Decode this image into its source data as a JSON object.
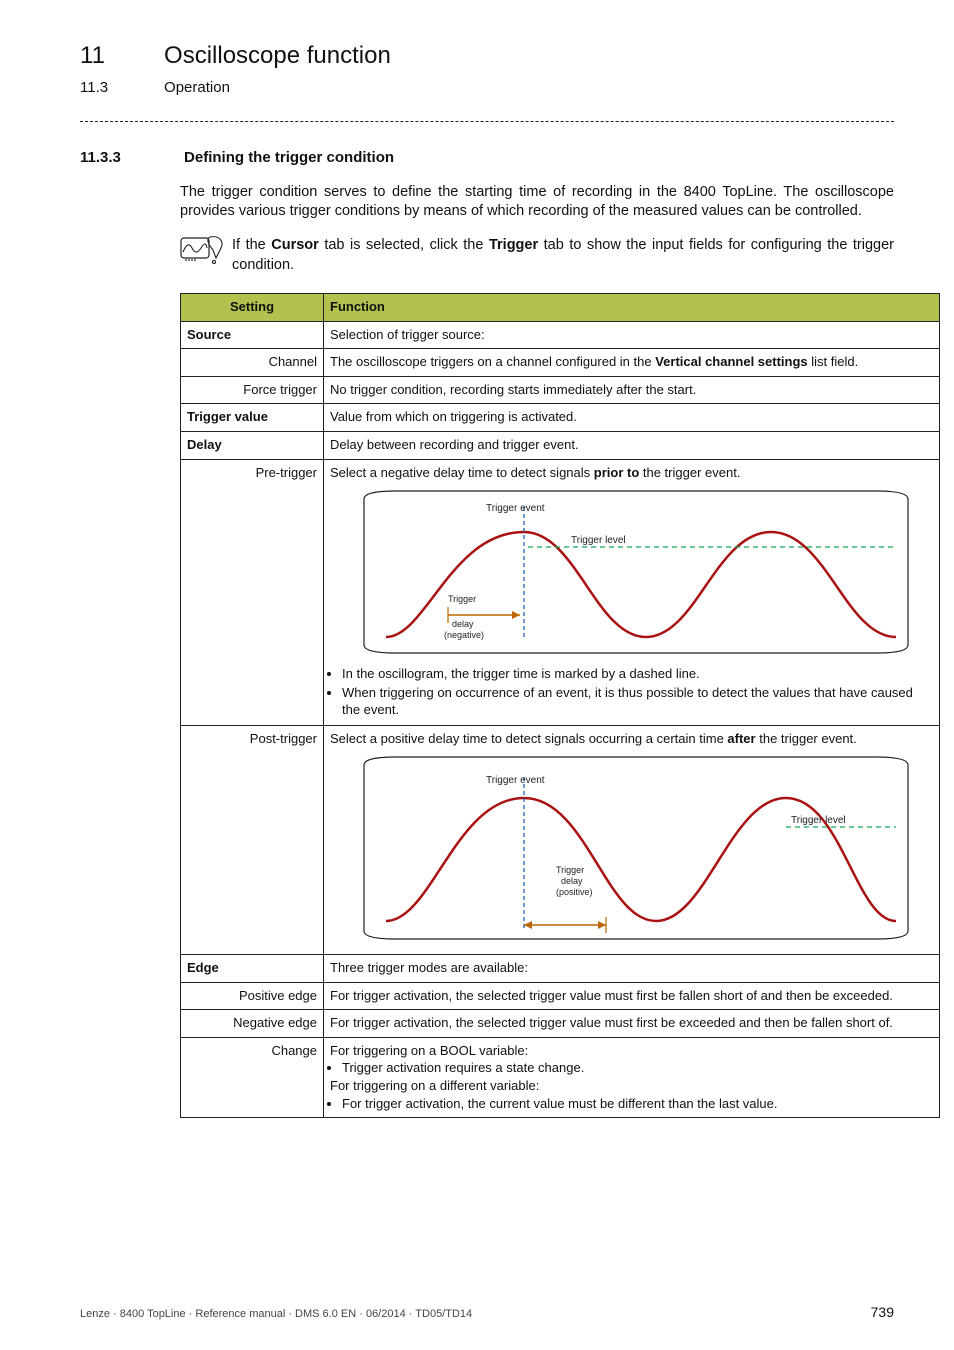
{
  "header": {
    "chapter_num": "11",
    "chapter_title": "Oscilloscope function",
    "sub_num": "11.3",
    "sub_title": "Operation"
  },
  "section": {
    "num": "11.3.3",
    "title": "Defining the trigger condition",
    "para": "The trigger condition serves to define the starting time of recording in the 8400 TopLine. The oscilloscope provides various trigger conditions by means of which recording of the measured values can be controlled."
  },
  "tip": {
    "prefix": "If the ",
    "cursor": "Cursor",
    "mid": " tab is selected, click the ",
    "trigger": "Trigger",
    "suffix": " tab to show the input fields for configuring the trigger condition."
  },
  "table": {
    "head_setting": "Setting",
    "head_function": "Function",
    "rows": {
      "source": {
        "label": "Source",
        "fn": "Selection of trigger source:"
      },
      "channel": {
        "label": "Channel",
        "fn_prefix": "The oscilloscope triggers on a channel configured in the ",
        "fn_bold": "Vertical channel settings",
        "fn_suffix": " list field."
      },
      "force_trigger": {
        "label": "Force trigger",
        "fn": "No trigger condition, recording starts immediately after the start."
      },
      "trigger_value": {
        "label": "Trigger value",
        "fn": "Value from which on triggering is activated."
      },
      "delay": {
        "label": "Delay",
        "fn": "Delay between recording and trigger event."
      },
      "pre_trigger": {
        "label": "Pre-trigger",
        "intro_a": "Select a negative delay time to detect signals ",
        "intro_b": "prior to",
        "intro_c": " the trigger event.",
        "bullets": [
          "In the oscillogram, the trigger time is marked by a dashed line.",
          "When triggering on occurrence of an event, it is thus possible to detect the values that have caused the event."
        ],
        "diagram": {
          "trigger_event": "Trigger event",
          "trigger_level": "Trigger level",
          "delay_l1": "Trigger",
          "delay_l2": "delay",
          "delay_l3": "(negative)"
        }
      },
      "post_trigger": {
        "label": "Post-trigger",
        "intro_a": "Select a positive delay time to detect signals occurring a certain time ",
        "intro_b": "after",
        "intro_c": " the trigger event.",
        "diagram": {
          "trigger_event": "Trigger event",
          "trigger_level": "Trigger level",
          "delay_l1": "Trigger",
          "delay_l2": "delay",
          "delay_l3": "(positive)"
        }
      },
      "edge": {
        "label": "Edge",
        "fn": "Three trigger modes are available:"
      },
      "positive_edge": {
        "label": "Positive edge",
        "fn": "For trigger activation, the selected trigger value must first be fallen short of and then be exceeded."
      },
      "negative_edge": {
        "label": "Negative edge",
        "fn": "For trigger activation, the selected trigger value must first be exceeded and then be fallen short of."
      },
      "change": {
        "label": "Change",
        "line1": "For triggering on a BOOL variable:",
        "bullet1": "Trigger activation requires a state change.",
        "line2": "For triggering on a different variable:",
        "bullet2": "For trigger activation, the current value must be different than the last value."
      }
    }
  },
  "footer": {
    "left": "Lenze · 8400 TopLine · Reference manual · DMS 6.0 EN · 06/2014 · TD05/TD14",
    "page": "739"
  }
}
